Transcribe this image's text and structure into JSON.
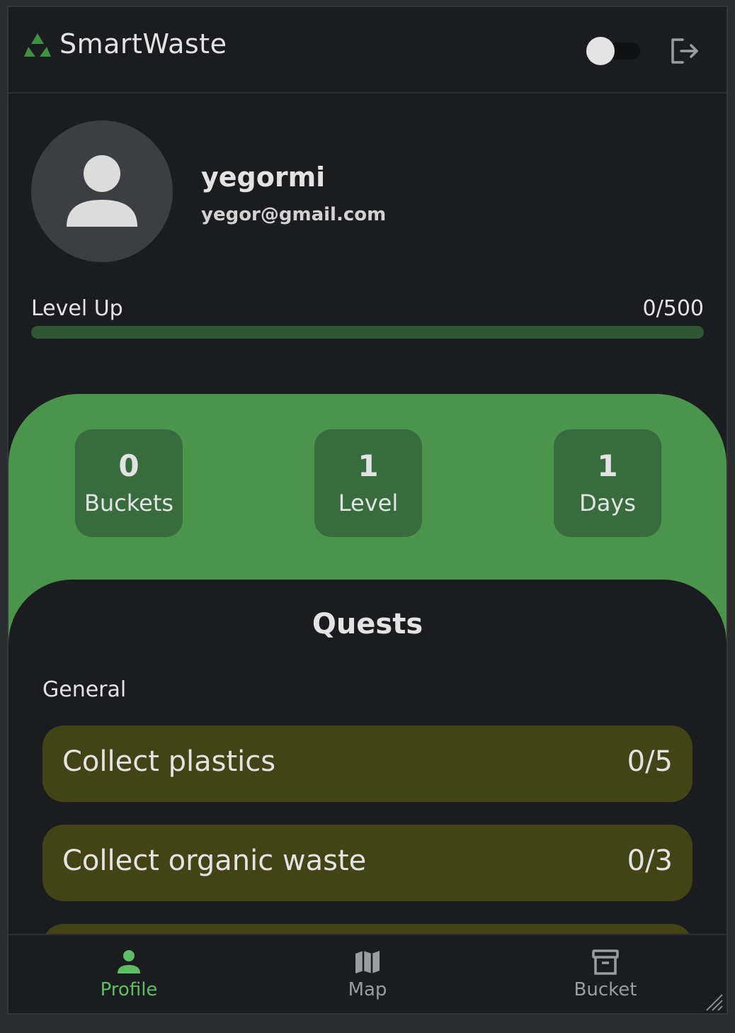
{
  "app": {
    "title": "SmartWaste",
    "logo_icon": "recycle-icon"
  },
  "header": {
    "theme_toggle_on": false,
    "logout_icon": "logout-icon"
  },
  "profile": {
    "username": "yegormi",
    "email": "yegor@gmail.com",
    "avatar_icon": "person-icon"
  },
  "level_progress": {
    "label": "Level Up",
    "value_text": "0/500",
    "current": 0,
    "max": 500
  },
  "stats": [
    {
      "value": "0",
      "label": "Buckets"
    },
    {
      "value": "1",
      "label": "Level"
    },
    {
      "value": "1",
      "label": "Days"
    }
  ],
  "quests": {
    "title": "Quests",
    "section": "General",
    "items": [
      {
        "name": "Collect plastics",
        "progress": "0/5"
      },
      {
        "name": "Collect organic waste",
        "progress": "0/3"
      },
      {
        "name": "",
        "progress": ""
      }
    ]
  },
  "nav": {
    "items": [
      {
        "label": "Profile",
        "icon": "person-icon",
        "active": true
      },
      {
        "label": "Map",
        "icon": "map-icon",
        "active": false
      },
      {
        "label": "Bucket",
        "icon": "archive-box-icon",
        "active": false
      }
    ]
  },
  "colors": {
    "accent_green": "#4b944c",
    "stat_card": "#386c3e",
    "quest_card": "#434315",
    "active_nav": "#5fbe63",
    "background": "#1b1c1f"
  }
}
